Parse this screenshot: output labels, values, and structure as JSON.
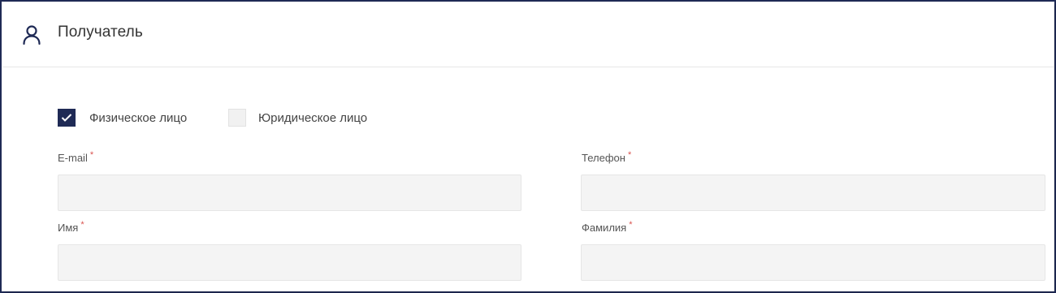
{
  "header": {
    "title": "Получатель",
    "icon": "user-icon"
  },
  "recipient_type": {
    "individual": {
      "label": "Физическое лицо",
      "checked": true
    },
    "legal": {
      "label": "Юридическое лицо",
      "checked": false
    }
  },
  "fields": {
    "email": {
      "label": "E-mail",
      "required_mark": "*",
      "value": ""
    },
    "phone": {
      "label": "Телефон",
      "required_mark": "*",
      "value": ""
    },
    "first_name": {
      "label": "Имя",
      "required_mark": "*",
      "value": ""
    },
    "last_name": {
      "label": "Фамилия",
      "required_mark": "*",
      "value": ""
    }
  },
  "colors": {
    "accent": "#1f2a55",
    "required": "#d9534f",
    "input_bg": "#f4f4f4"
  }
}
